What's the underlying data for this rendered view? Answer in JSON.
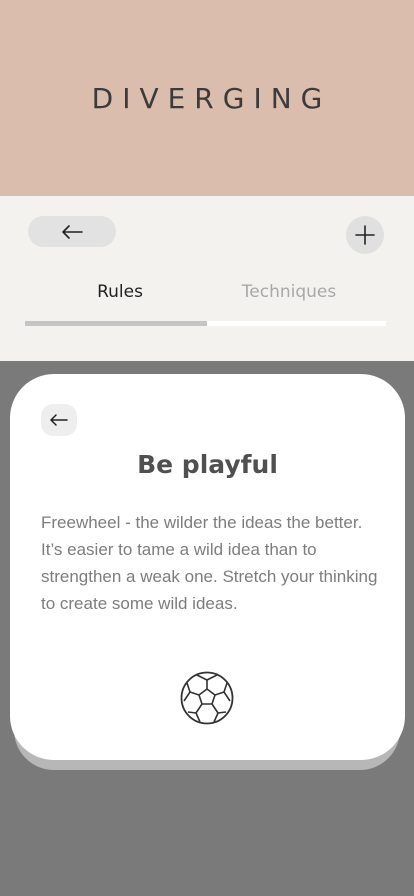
{
  "header": {
    "title": "DIVERGING",
    "background": "#dbbdae"
  },
  "controls": {
    "back_icon": "arrow-left-icon",
    "add_icon": "plus-icon"
  },
  "tabs": [
    {
      "label": "Rules",
      "active": true
    },
    {
      "label": "Techniques",
      "active": false
    }
  ],
  "card": {
    "back_icon": "arrow-left-icon",
    "title": "Be playful",
    "body_lines": [
      "Freewheel - the wilder the ideas the better.",
      "It’s easier to tame a wild idea than to strengthen a weak one. Stretch your thinking to create some wild ideas."
    ],
    "illustration": "soccer-ball-icon"
  },
  "colors": {
    "overlay": "#7a7a7a",
    "panel": "#f4f2ee",
    "active_tab": "#222222",
    "inactive_tab": "#a8a8a8"
  }
}
